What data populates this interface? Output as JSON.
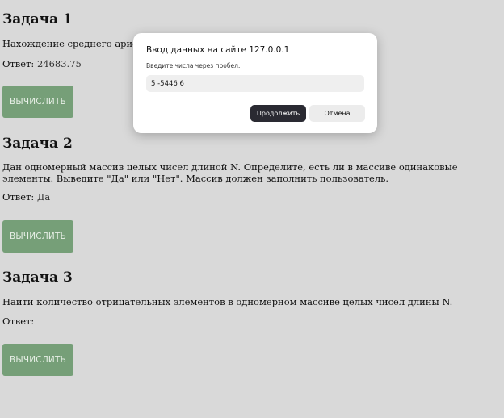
{
  "tasks": [
    {
      "title": "Задача 1",
      "description": "Нахождение среднего арифметич",
      "answer_label": "Ответ:",
      "answer_value": "24683.75",
      "button_label": "ВЫЧИСЛИТЬ"
    },
    {
      "title": "Задача 2",
      "description": "Дан одномерный массив целых чисел длиной N. Определите, есть ли в массиве одинаковые элементы. Выведите \"Да\" или \"Нет\". Массив должен заполнить пользователь.",
      "answer_label": "Ответ:",
      "answer_value": "Да",
      "button_label": "ВЫЧИСЛИТЬ"
    },
    {
      "title": "Задача 3",
      "description": "Найти количество отрицательных элементов в одномерном массиве целых чисел длины N.",
      "answer_label": "Ответ:",
      "answer_value": "",
      "button_label": "ВЫЧИСЛИТЬ"
    }
  ],
  "dialog": {
    "title": "Ввод данных на сайте 127.0.0.1",
    "prompt": "Введите числа через пробел:",
    "input_value": "5 -5446 6",
    "ok_label": "Продолжить",
    "cancel_label": "Отмена"
  },
  "colors": {
    "page_background": "#d9d9d9",
    "button_background": "#769f78",
    "dialog_ok_background": "#2a2a32"
  }
}
